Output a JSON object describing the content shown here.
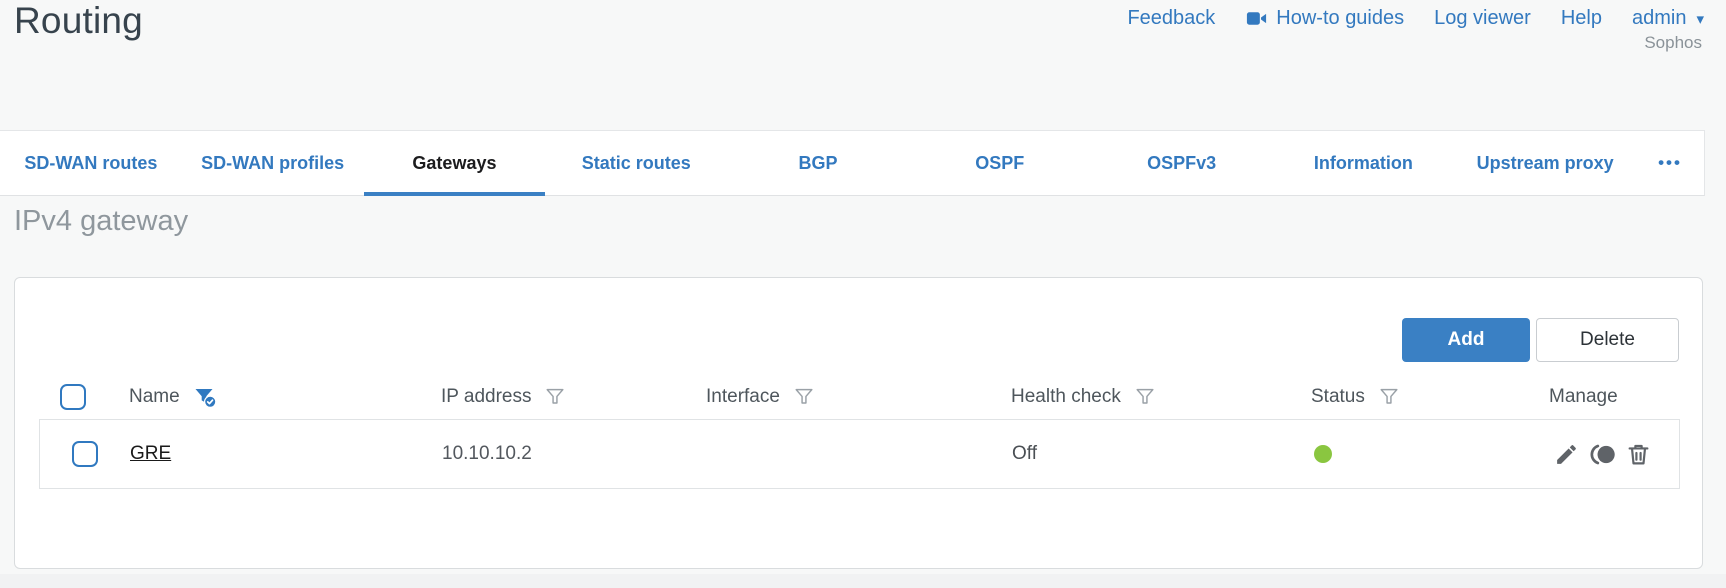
{
  "page": {
    "title": "Routing"
  },
  "header": {
    "links": [
      {
        "label": "Feedback"
      },
      {
        "label": "How-to guides",
        "icon": "video-camera-icon"
      },
      {
        "label": "Log viewer"
      },
      {
        "label": "Help"
      }
    ],
    "user_menu": {
      "label": "admin",
      "caret": "▾"
    },
    "brand": "Sophos"
  },
  "tabs": {
    "items": [
      {
        "label": "SD-WAN routes",
        "active": false
      },
      {
        "label": "SD-WAN profiles",
        "active": false
      },
      {
        "label": "Gateways",
        "active": true
      },
      {
        "label": "Static routes",
        "active": false
      },
      {
        "label": "BGP",
        "active": false
      },
      {
        "label": "OSPF",
        "active": false
      },
      {
        "label": "OSPFv3",
        "active": false
      },
      {
        "label": "Information",
        "active": false
      },
      {
        "label": "Upstream proxy",
        "active": false
      }
    ],
    "overflow_label": "•••"
  },
  "section": {
    "heading": "IPv4 gateway"
  },
  "toolbar": {
    "add_label": "Add",
    "delete_label": "Delete"
  },
  "table": {
    "columns": [
      {
        "label": "Name",
        "filter": "active"
      },
      {
        "label": "IP address",
        "filter": "inactive"
      },
      {
        "label": "Interface",
        "filter": "inactive"
      },
      {
        "label": "Health check",
        "filter": "inactive"
      },
      {
        "label": "Status",
        "filter": "inactive"
      },
      {
        "label": "Manage",
        "filter": "none"
      }
    ],
    "rows": [
      {
        "name": "GRE",
        "ip_address": "10.10.10.2",
        "interface": "",
        "health_check": "Off",
        "status": "up",
        "manage_icons": [
          "edit",
          "deactivate",
          "delete"
        ]
      }
    ]
  },
  "colors": {
    "accent_blue": "#3379bf",
    "add_button_blue": "#3a80c4",
    "status_up_green": "#8ac640",
    "icon_gray": "#5f6368"
  }
}
